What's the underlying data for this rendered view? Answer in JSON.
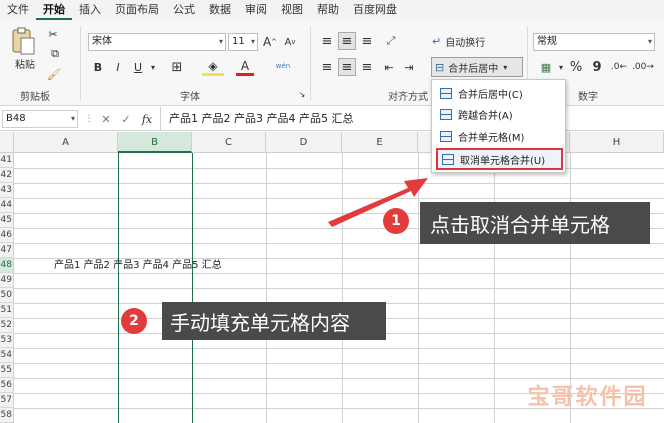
{
  "menubar": {
    "items": [
      "文件",
      "开始",
      "插入",
      "页面布局",
      "公式",
      "数据",
      "审阅",
      "视图",
      "帮助",
      "百度网盘"
    ]
  },
  "clipboard": {
    "paste_label": "粘贴",
    "group_label": "剪贴板"
  },
  "font": {
    "name": "宋体",
    "size": "11",
    "bold": "B",
    "italic": "I",
    "underline": "U",
    "font_color_glyph": "A",
    "wen_glyph": "wén",
    "group_label": "字体"
  },
  "alignment": {
    "wrap_label": "自动换行",
    "merge_center_label": "合并后居中",
    "group_label": "对齐方式"
  },
  "number": {
    "format": "常规",
    "percent": "%",
    "comma": "9",
    "group_label": "数字"
  },
  "merge_menu": {
    "items": [
      "合并后居中(C)",
      "跨越合并(A)",
      "合并单元格(M)",
      "取消单元格合并(U)"
    ]
  },
  "formula_bar": {
    "cell_ref": "B48",
    "fx": "fx",
    "content": "产品1 产品2 产品3 产品4 产品5 汇总",
    "cancel_glyph": "✕",
    "confirm_glyph": "✓"
  },
  "sheet": {
    "columns": [
      "A",
      "B",
      "C",
      "D",
      "E",
      "F",
      "G",
      "H"
    ],
    "rows": [
      "41",
      "42",
      "43",
      "44",
      "45",
      "46",
      "47",
      "48",
      "49",
      "50",
      "51",
      "52",
      "53",
      "54",
      "55",
      "56",
      "57",
      "58"
    ],
    "cell_text": "产品1  产品2  产品3  产品4  产品5  汇总"
  },
  "callouts": [
    {
      "num": "1",
      "text": "点击取消合并单元格"
    },
    {
      "num": "2",
      "text": "手动填充单元格内容"
    }
  ],
  "watermark": "宝哥软件园",
  "colors": {
    "highlight_red": "#d9363e",
    "badge_red": "#e23b3b",
    "callout_bg": "#4a4a4a",
    "excel_green": "#1e7145"
  }
}
